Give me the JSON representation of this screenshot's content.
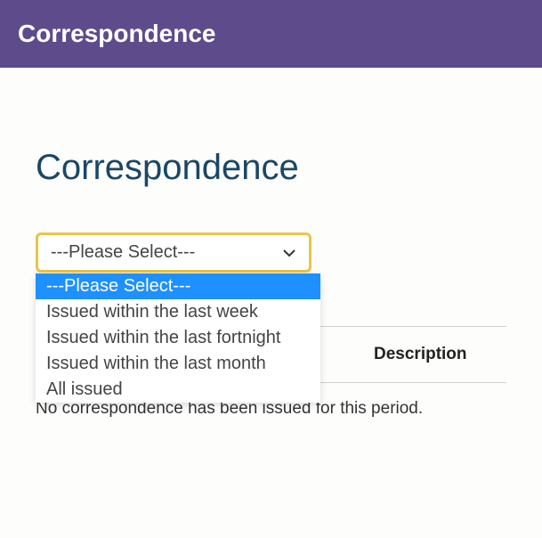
{
  "header": {
    "title": "Correspondence"
  },
  "page": {
    "title": "Correspondence"
  },
  "filter": {
    "selected": "---Please Select---",
    "options": [
      "---Please Select---",
      "Issued within the last week",
      "Issued within the last fortnight",
      "Issued within the last month",
      "All issued"
    ]
  },
  "table": {
    "columns": {
      "description": "Description"
    }
  },
  "status": {
    "empty_message": "No correspondence has been issued for this period."
  }
}
